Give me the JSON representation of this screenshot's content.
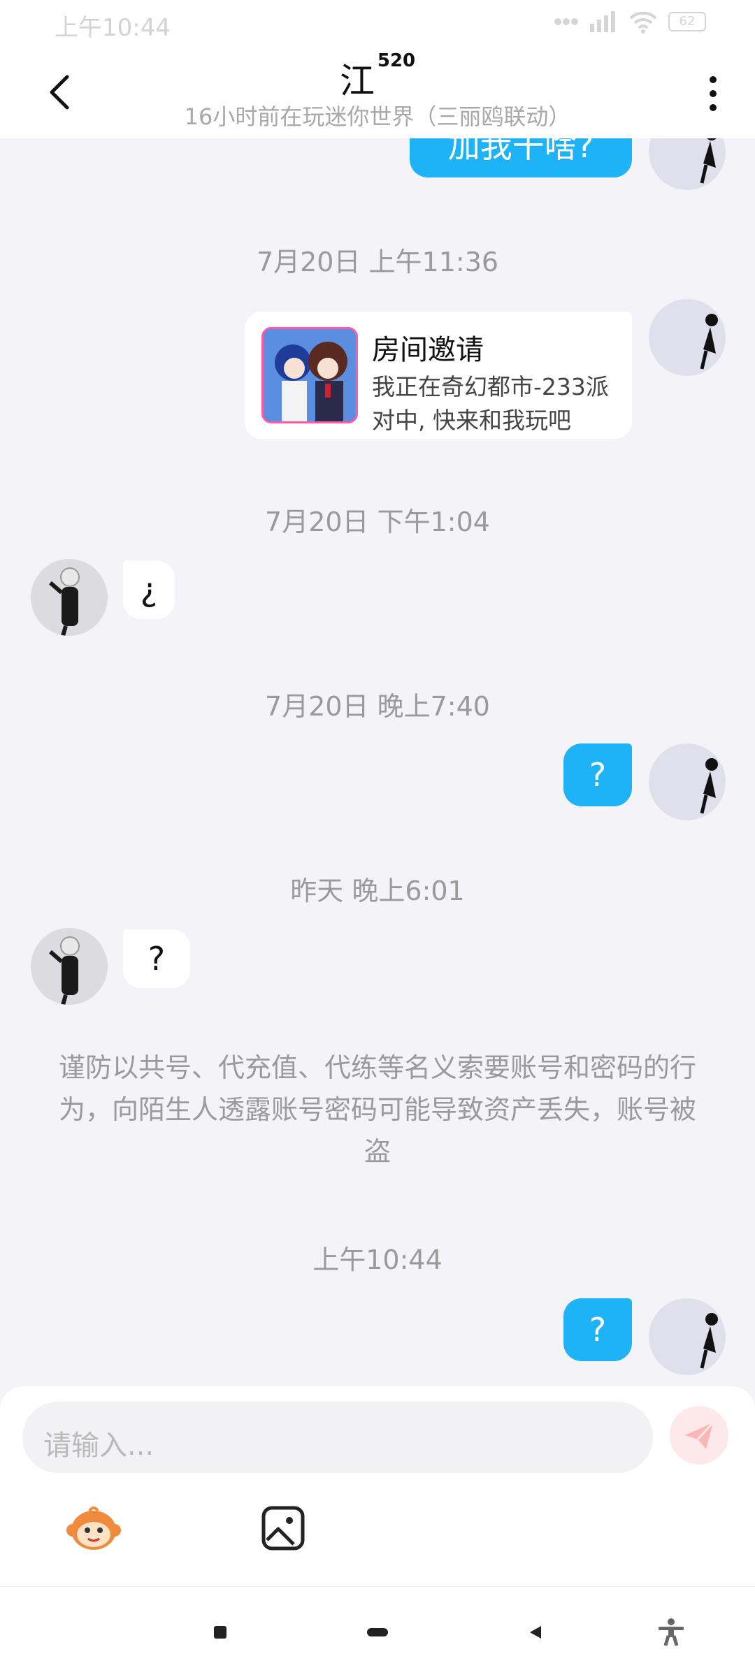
{
  "status_bar": {
    "time": "上午10:44",
    "battery": "62"
  },
  "header": {
    "title": "江",
    "title_badge": "520",
    "subtitle": "16小时前在玩迷你世界（三丽鸥联动）"
  },
  "messages": {
    "top_partial_text": "加我干啥?",
    "ts1": "7月20日 上午11:36",
    "invite": {
      "title": "房间邀请",
      "desc": "我正在奇幻都市-233派对中, 快来和我玩吧"
    },
    "ts2": "7月20日 下午1:04",
    "msg_left1": "¿",
    "ts3": "7月20日 晚上7:40",
    "msg_right1": "?",
    "ts4": "昨天 晚上6:01",
    "msg_left2": "?",
    "notice": "谨防以共号、代充值、代练等名义索要账号和密码的行为，向陌生人透露账号密码可能导致资产丢失，账号被盗",
    "ts5": "上午10:44",
    "msg_right2": "?"
  },
  "input": {
    "placeholder": "请输入..."
  },
  "colors": {
    "accent": "#1eb3f6",
    "background": "#f4f4f8"
  }
}
